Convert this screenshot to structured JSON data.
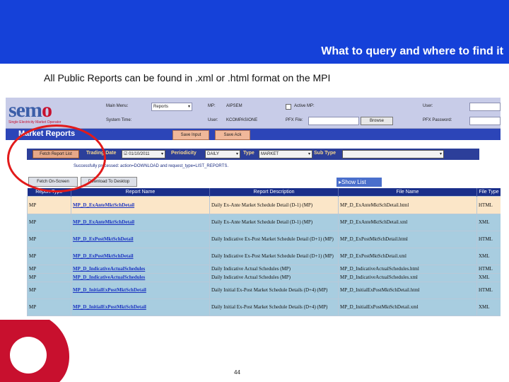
{
  "slide": {
    "title": "What to query and where to find it",
    "subtitle": "All Public Reports can be found in .xml or .html format on the MPI",
    "page_number": "44"
  },
  "colors": {
    "top_bar": "#1541d9",
    "highlight": "#e21b1b",
    "brand_red": "#c8102e",
    "nav_blue": "#2c45b8"
  },
  "app": {
    "logo": {
      "text_start": "sem",
      "text_end": "o",
      "tagline": "Single Electricity Market Operator"
    },
    "header": {
      "main_menu_label": "Main Menu:",
      "main_menu_value": "Reports",
      "mp_label": "MP:",
      "mp_value": "AIPSEM",
      "active_mp_label": "Active MP:",
      "system_time_label": "System Time:",
      "user_label_mid": "User:",
      "user_value": "KCOMPASIONE",
      "pfx_file_label": "PFX File:",
      "browse_label": "Browse",
      "user_label_right": "User:",
      "pfx_password_label": "PFX Password:"
    },
    "nav": {
      "title": "Market Reports",
      "save_input": "Save Input",
      "save_ack": "Save Ack"
    },
    "filter": {
      "fetch_report_list": "Fetch Report List",
      "trading_date_label": "Trading Date",
      "trading_date_value": "01/10/2011",
      "periodicity_label": "Periodicity",
      "periodicity_value": "DAILY",
      "type_label": "Type",
      "type_value": "MARKET",
      "sub_type_label": "Sub Type"
    },
    "status": "Successfully processed: action=DOWNLOAD and request_type=LIST_REPORTS.",
    "actions": {
      "fetch_on_screen": "Fetch On-Screen",
      "download_to_desktop": "Download To Desktop",
      "show_list": "Show List"
    },
    "table": {
      "columns": [
        "Report Type",
        "Report Name",
        "Report Description",
        "File Name",
        "File Type"
      ],
      "rows": [
        {
          "code": "MP",
          "name": "MP_D_ExAnteMktSchDetail",
          "desc": "Daily Ex-Ante Market Schedule Detail (D-1) (MP)",
          "file": "MP_D_ExAnteMktSchDetail.html",
          "type": "HTML"
        },
        {
          "code": "MP",
          "name": "MP_D_ExAnteMktSchDetail",
          "desc": "Daily Ex-Ante Market Schedule Detail (D-1) (MP)",
          "file": "MP_D_ExAnteMktSchDetail.xml",
          "type": "XML"
        },
        {
          "code": "MP",
          "name": "MP_D_ExPostMktSchDetail",
          "desc": "Daily Indicative Ex-Post Market Schedule Detail (D+1) (MP)",
          "file": "MP_D_ExPostMktSchDetail.html",
          "type": "HTML"
        },
        {
          "code": "MP",
          "name": "MP_D_ExPostMktSchDetail",
          "desc": "Daily Indicative Ex-Post Market Schedule Detail (D+1) (MP)",
          "file": "MP_D_ExPostMktSchDetail.xml",
          "type": "XML"
        },
        {
          "code": "MP",
          "name": "MP_D_IndicativeActualSchedules",
          "desc": "Daily Indicative Actual Schedules (MP)",
          "file": "MP_D_IndicativeActualSchedules.html",
          "type": "HTML"
        },
        {
          "code": "MP",
          "name": "MP_D_IndicativeActualSchedules",
          "desc": "Daily Indicative Actual Schedules (MP)",
          "file": "MP_D_IndicativeActualSchedules.xml",
          "type": "XML"
        },
        {
          "code": "MP",
          "name": "MP_D_InitialExPostMktSchDetail",
          "desc": "Daily Initial Ex-Post Market Schedule Details (D+4) (MP)",
          "file": "MP_D_InitialExPostMktSchDetail.html",
          "type": "HTML"
        },
        {
          "code": "MP",
          "name": "MP_D_InitialExPostMktSchDetail",
          "desc": "Daily Initial Ex-Post Market Schedule Details (D+4) (MP)",
          "file": "MP_D_InitialExPostMktSchDetail.xml",
          "type": "XML"
        }
      ]
    }
  }
}
